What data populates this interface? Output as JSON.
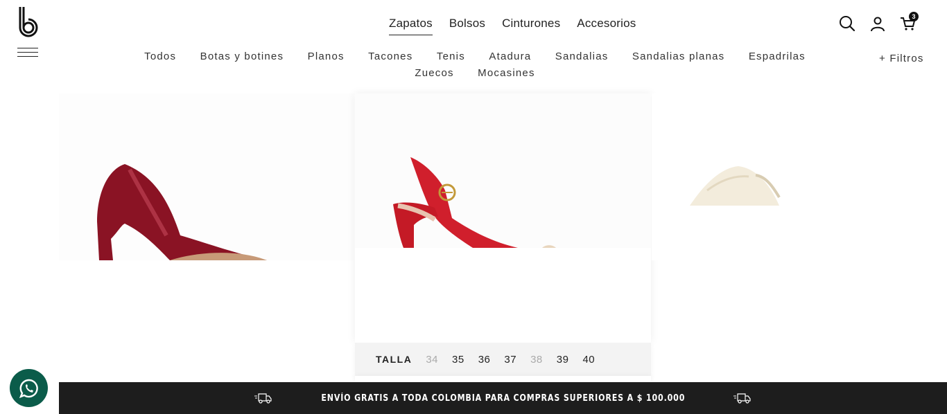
{
  "brand": {
    "logo": "b"
  },
  "main_nav": [
    {
      "label": "Zapatos",
      "active": true
    },
    {
      "label": "Bolsos"
    },
    {
      "label": "Cinturones"
    },
    {
      "label": "Accesorios"
    }
  ],
  "sub_nav": [
    "Todos",
    "Botas y botines",
    "Planos",
    "Tacones",
    "Tenis",
    "Atadura",
    "Sandalias",
    "Sandalias planas",
    "Espadrilas",
    "Zuecos",
    "Mocasines"
  ],
  "filters_label": "+ Filtros",
  "header_icons": {
    "search": "search-icon",
    "account": "user-icon",
    "cart": "cart-icon",
    "cart_count": "3"
  },
  "sizes": {
    "label": "TALLA",
    "options": [
      {
        "value": "34",
        "available": false
      },
      {
        "value": "35",
        "available": true
      },
      {
        "value": "36",
        "available": true
      },
      {
        "value": "37",
        "available": true
      },
      {
        "value": "38",
        "available": false
      },
      {
        "value": "39",
        "available": true
      },
      {
        "value": "40",
        "available": true
      }
    ]
  },
  "banner": {
    "text": "ENVÍO GRATIS A TODA COLOMBIA PARA COMPRAS SUPERIORES A $ 100.000"
  },
  "colors": {
    "banner_bg": "#1d1d1d",
    "whatsapp": "#0b5c4a",
    "burgundy": "#8a1324",
    "red": "#d01f2c"
  }
}
